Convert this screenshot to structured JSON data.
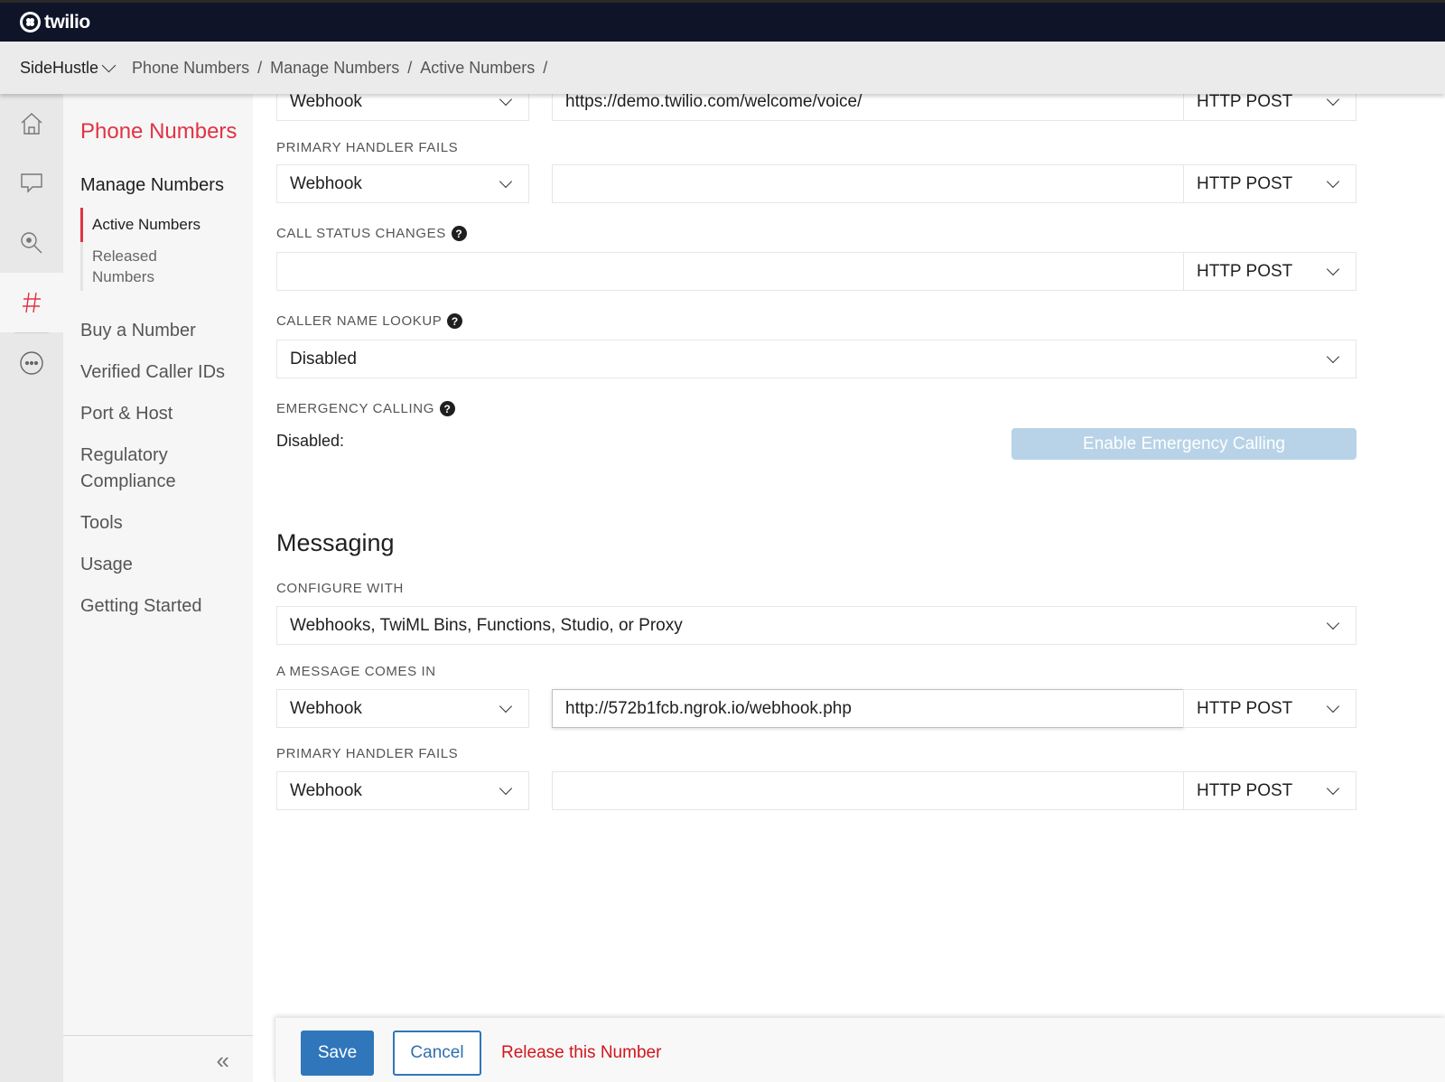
{
  "brand": {
    "logo_text": "twilio",
    "accent_color": "#e03344",
    "topbar_color": "#0f1428"
  },
  "breadcrumb": {
    "account": "SideHustle",
    "items": [
      "Phone Numbers",
      "Manage Numbers",
      "Active Numbers"
    ],
    "separator": "/"
  },
  "rail": {
    "items": [
      {
        "icon": "home-icon",
        "active": false
      },
      {
        "icon": "chat-icon",
        "active": false
      },
      {
        "icon": "search-icon",
        "active": false
      },
      {
        "icon": "hash-icon",
        "active": true
      },
      {
        "icon": "more-icon",
        "active": false
      }
    ]
  },
  "subnav": {
    "title": "Phone Numbers",
    "group": "Manage Numbers",
    "sub_items": [
      {
        "label": "Active Numbers",
        "active": true
      },
      {
        "label": "Released Numbers",
        "active": false
      }
    ],
    "links": [
      "Buy a Number",
      "Verified Caller IDs",
      "Port & Host",
      "Regulatory Compliance",
      "Tools",
      "Usage",
      "Getting Started"
    ],
    "collapse_icon": "«"
  },
  "voice": {
    "call_comes_in": {
      "type": "Webhook",
      "url": "https://demo.twilio.com/welcome/voice/",
      "method": "HTTP POST"
    },
    "primary_handler_fails": {
      "label": "PRIMARY HANDLER FAILS",
      "type": "Webhook",
      "url": "",
      "method": "HTTP POST"
    },
    "call_status_changes": {
      "label": "CALL STATUS CHANGES",
      "url": "",
      "method": "HTTP POST"
    },
    "caller_name_lookup": {
      "label": "CALLER NAME LOOKUP",
      "value": "Disabled"
    },
    "emergency_calling": {
      "label": "EMERGENCY CALLING",
      "status": "Disabled:",
      "button": "Enable Emergency Calling"
    }
  },
  "messaging": {
    "title": "Messaging",
    "configure_with": {
      "label": "CONFIGURE WITH",
      "value": "Webhooks, TwiML Bins, Functions, Studio, or Proxy"
    },
    "message_comes_in": {
      "label": "A MESSAGE COMES IN",
      "type": "Webhook",
      "url": "http://572b1fcb.ngrok.io/webhook.php",
      "method": "HTTP POST"
    },
    "primary_handler_fails": {
      "label": "PRIMARY HANDLER FAILS",
      "type": "Webhook",
      "url": "",
      "method": "HTTP POST"
    }
  },
  "footer": {
    "save": "Save",
    "cancel": "Cancel",
    "release": "Release this Number"
  },
  "help_glyph": "?"
}
